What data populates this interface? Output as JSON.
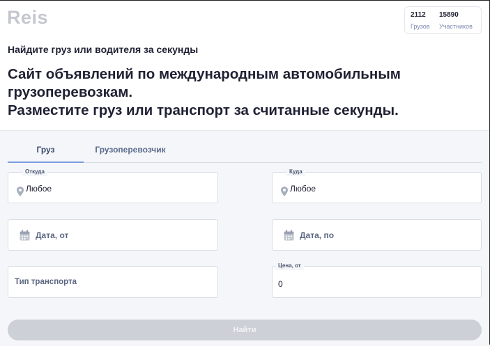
{
  "brand": {
    "logo_text": "Reis"
  },
  "stats": [
    {
      "value": "2112",
      "label": "Грузов"
    },
    {
      "value": "15890",
      "label": "Участников"
    }
  ],
  "hero": {
    "subtitle": "Найдите груз или водителя за секунды",
    "headline_lines": [
      "Сайт объявлений по международным автомобильным",
      "грузоперевозкам.",
      "Разместите груз или транспорт за считанные секунды."
    ]
  },
  "tabs": [
    {
      "label": "Груз",
      "active": true
    },
    {
      "label": "Грузоперевозчик",
      "active": false
    }
  ],
  "form": {
    "from": {
      "label": "Откуда",
      "value": "Любое"
    },
    "to": {
      "label": "Куда",
      "value": "Любое"
    },
    "date_from": {
      "placeholder": "Дата, от"
    },
    "date_to": {
      "placeholder": "Дата, по"
    },
    "transport_type": {
      "placeholder": "Тип транспорта"
    },
    "price_from": {
      "label": "Цена, от",
      "value": "0"
    },
    "submit_label": "Найти"
  },
  "colors": {
    "tab_indicator": "#7a9be0",
    "button_disabled": "#cdd0d6",
    "logo": "#c4c7cf",
    "panel_bg": "#f5f6f9"
  },
  "icons": {
    "location": "map-pin-icon",
    "calendar": "calendar-icon"
  }
}
